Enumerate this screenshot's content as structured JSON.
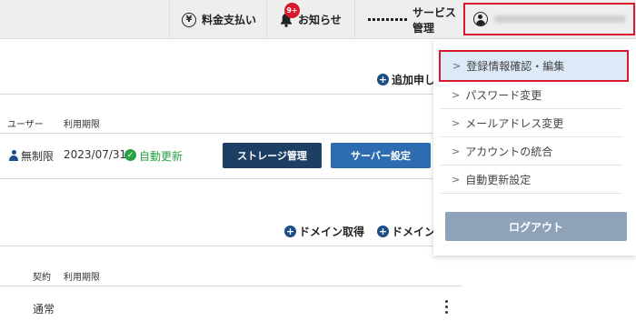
{
  "header": {
    "billing_label": "料金支払い",
    "notifications_label": "お知らせ",
    "notification_badge": "9+",
    "services_label": "サービス管理"
  },
  "main": {
    "add_request_label": "追加申し",
    "columns": {
      "user": "ユーザー",
      "period": "利用期限"
    },
    "row": {
      "user_value": "無制限",
      "period_value": "2023/07/31",
      "renew_status": "自動更新"
    },
    "storage_button": "ストレージ管理",
    "server_button": "サーバー設定",
    "domain_acquire_label": "ドメイン取得",
    "domain_other_label": "ドメイン",
    "columns2": {
      "contract": "契約",
      "period": "利用期限"
    },
    "row2": {
      "contract_value": "通常"
    }
  },
  "dropdown": {
    "items": [
      {
        "label": "登録情報確認・編集"
      },
      {
        "label": "パスワード変更"
      },
      {
        "label": "メールアドレス変更"
      },
      {
        "label": "アカウントの統合"
      },
      {
        "label": "自動更新設定"
      }
    ],
    "logout_label": "ログアウト"
  },
  "colors": {
    "accent_red": "#d7192b",
    "brand_navy": "#1e3f64",
    "brand_blue": "#2e6cb1",
    "success_green": "#2aa148",
    "logout_gray": "#8ea2b9"
  },
  "icons": [
    "yen-icon",
    "bell-icon",
    "grid-icon",
    "user-icon",
    "plus-icon",
    "check-icon",
    "chevron-right-icon",
    "kebab-icon"
  ]
}
